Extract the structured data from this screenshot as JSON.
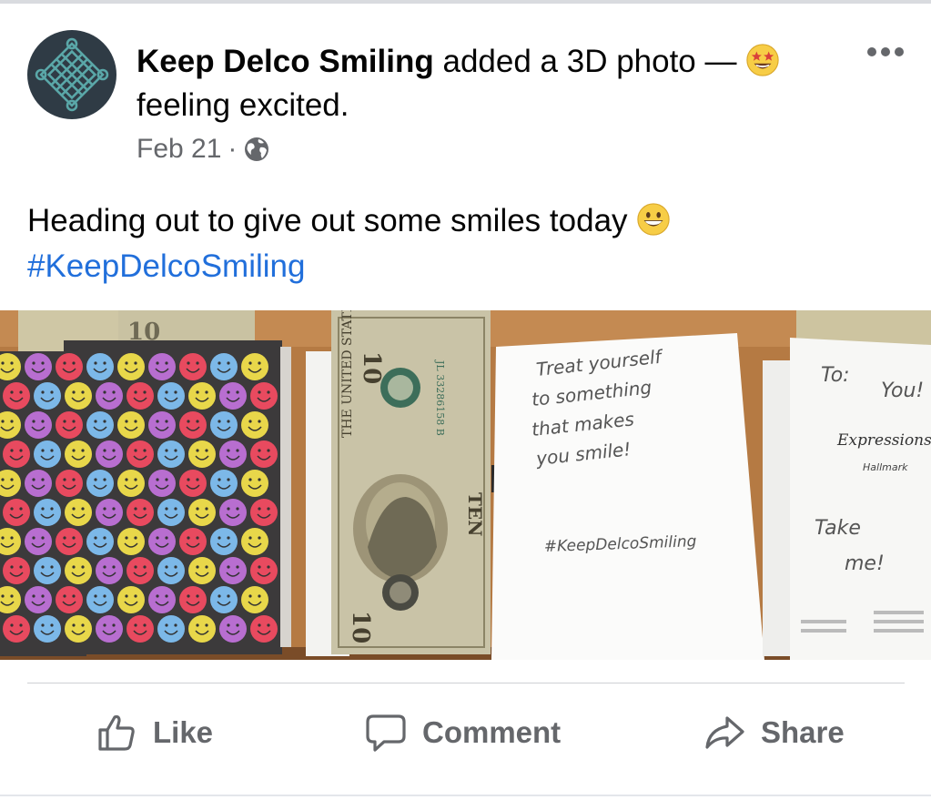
{
  "post": {
    "author": "Keep Delco Smiling",
    "action": "added a 3D photo",
    "dash": "—",
    "feeling_icon": "star-struck-emoji",
    "feeling_text": "feeling excited.",
    "date": "Feb 21",
    "separator": "·",
    "privacy_icon": "globe-icon",
    "body_text": "Heading out to give out some smiles today",
    "body_emoji": "grinning-face-emoji",
    "hashtag": "#KeepDelcoSmiling",
    "more_icon": "more-options-icon"
  },
  "photo": {
    "card_note_lines": [
      "Treat yourself",
      "to something",
      "that makes",
      "you smile!"
    ],
    "card_hashtag": "#KeepDelcoSmiling",
    "card_to": "To:",
    "card_you": "You!",
    "card_brand": "Expressions",
    "card_brand_sub": "Hallmark",
    "card_take": "Take",
    "card_me": "me!",
    "bill_denomination": "10",
    "bill_words": "TEN",
    "bill_header": "THE UNITED STATES OF AMERICA",
    "bill_serial": "JL 33286158 B",
    "colors": {
      "table": "#b57a43",
      "card_dark": "#3c3a3b",
      "bill": "#c9c3a7"
    }
  },
  "actions": {
    "like": "Like",
    "comment": "Comment",
    "share": "Share"
  },
  "colors": {
    "hashtag": "#216fdb",
    "secondary_text": "#65676b",
    "avatar_bg": "#2f3b45",
    "avatar_knot": "#5aa7a8"
  }
}
